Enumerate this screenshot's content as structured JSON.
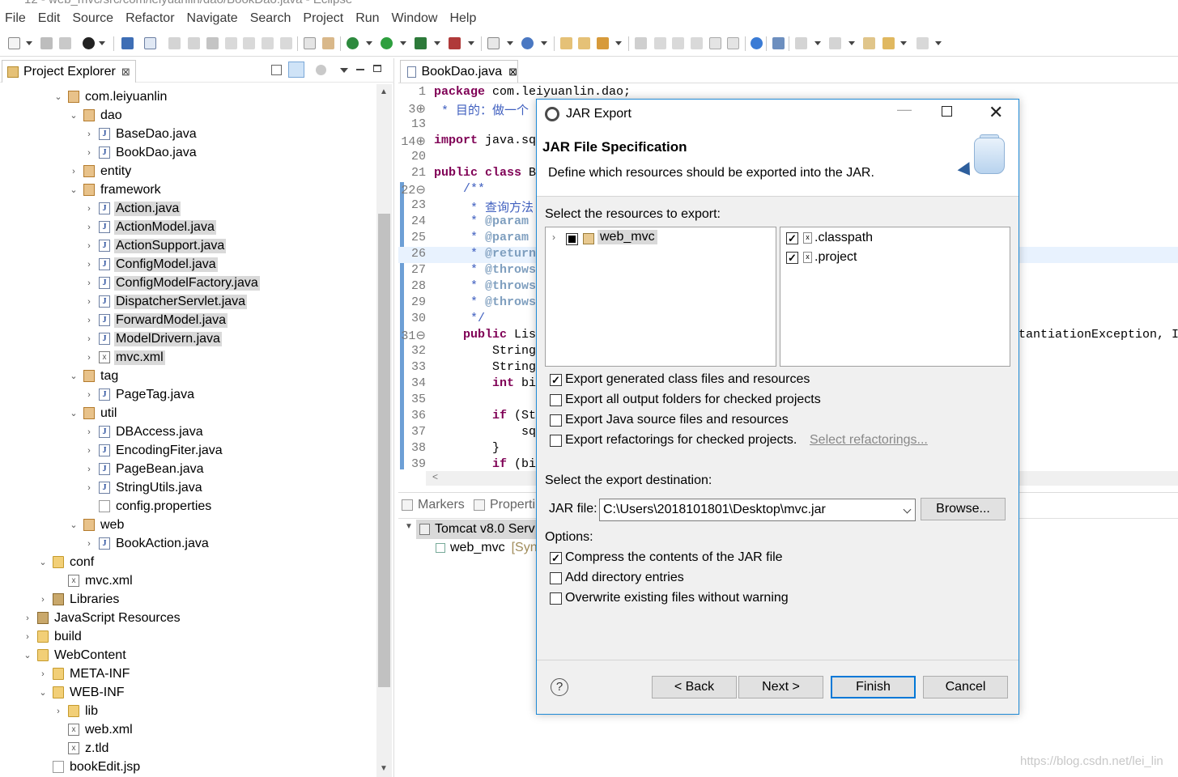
{
  "window": {
    "title": "12 - web_mvc/src/com/leiyuanlin/dao/BookDao.java - Eclipse"
  },
  "menubar": {
    "items": [
      "File",
      "Edit",
      "Source",
      "Refactor",
      "Navigate",
      "Search",
      "Project",
      "Run",
      "Window",
      "Help"
    ]
  },
  "project_explorer": {
    "tab_label": "Project Explorer",
    "close_symbol": "⊠",
    "tree": [
      {
        "label": "com.leiyuanlin",
        "icon": "package-icon",
        "expanded": true,
        "depth": 0
      },
      {
        "label": "dao",
        "icon": "package-icon",
        "expanded": true,
        "depth": 1
      },
      {
        "label": "BaseDao.java",
        "icon": "java-file-icon",
        "depth": 2
      },
      {
        "label": "BookDao.java",
        "icon": "java-file-icon",
        "depth": 2
      },
      {
        "label": "entity",
        "icon": "package-icon",
        "expanded": false,
        "depth": 1
      },
      {
        "label": "framework",
        "icon": "package-icon",
        "expanded": true,
        "depth": 1
      },
      {
        "label": "Action.java",
        "icon": "java-file-icon",
        "depth": 2,
        "selected": true
      },
      {
        "label": "ActionModel.java",
        "icon": "java-file-icon",
        "depth": 2,
        "selected": true
      },
      {
        "label": "ActionSupport.java",
        "icon": "java-file-icon",
        "depth": 2,
        "selected": true
      },
      {
        "label": "ConfigModel.java",
        "icon": "java-file-icon",
        "depth": 2,
        "selected": true
      },
      {
        "label": "ConfigModelFactory.java",
        "icon": "java-file-icon",
        "depth": 2,
        "selected": true
      },
      {
        "label": "DispatcherServlet.java",
        "icon": "java-file-icon",
        "depth": 2,
        "selected": true
      },
      {
        "label": "ForwardModel.java",
        "icon": "java-file-icon",
        "depth": 2,
        "selected": true
      },
      {
        "label": "ModelDrivern.java",
        "icon": "java-file-icon",
        "depth": 2,
        "selected": true
      },
      {
        "label": "mvc.xml",
        "icon": "xml-file-icon",
        "depth": 2,
        "selected": true
      },
      {
        "label": "tag",
        "icon": "package-icon",
        "expanded": true,
        "depth": 1
      },
      {
        "label": "PageTag.java",
        "icon": "java-file-icon",
        "depth": 2
      },
      {
        "label": "util",
        "icon": "package-icon",
        "expanded": true,
        "depth": 1
      },
      {
        "label": "DBAccess.java",
        "icon": "java-file-icon",
        "depth": 2
      },
      {
        "label": "EncodingFiter.java",
        "icon": "java-file-icon",
        "depth": 2
      },
      {
        "label": "PageBean.java",
        "icon": "java-file-icon",
        "depth": 2
      },
      {
        "label": "StringUtils.java",
        "icon": "java-file-icon",
        "depth": 2
      },
      {
        "label": "config.properties",
        "icon": "properties-file-icon",
        "depth": 2,
        "leaf": true
      },
      {
        "label": "web",
        "icon": "package-icon",
        "expanded": true,
        "depth": 1
      },
      {
        "label": "BookAction.java",
        "icon": "java-file-icon",
        "depth": 2
      },
      {
        "label": "conf",
        "icon": "source-folder-icon",
        "expanded": true,
        "depth": -1
      },
      {
        "label": "mvc.xml",
        "icon": "xml-file-icon",
        "depth": 0,
        "leaf": true
      },
      {
        "label": "Libraries",
        "icon": "library-icon",
        "expanded": false,
        "depth": -1
      },
      {
        "label": "JavaScript Resources",
        "icon": "js-resources-icon",
        "expanded": false,
        "depth": -2
      },
      {
        "label": "build",
        "icon": "folder-icon",
        "expanded": false,
        "depth": -2
      },
      {
        "label": "WebContent",
        "icon": "folder-icon",
        "expanded": true,
        "depth": -2
      },
      {
        "label": "META-INF",
        "icon": "folder-icon",
        "expanded": false,
        "depth": -1
      },
      {
        "label": "WEB-INF",
        "icon": "folder-icon",
        "expanded": true,
        "depth": -1
      },
      {
        "label": "lib",
        "icon": "folder-icon",
        "expanded": false,
        "depth": 0
      },
      {
        "label": "web.xml",
        "icon": "xml-file-icon",
        "depth": 0,
        "leaf": true
      },
      {
        "label": "z.tld",
        "icon": "xml-file-icon",
        "depth": 0,
        "leaf": true
      },
      {
        "label": "bookEdit.jsp",
        "icon": "jsp-file-icon",
        "depth": -1,
        "leaf": true
      }
    ]
  },
  "editor": {
    "tab_label": "BookDao.java",
    "lines": [
      {
        "num": "1",
        "parts": [
          [
            "kw",
            "package"
          ],
          [
            "",
            "com.leiyuanlin.dao;"
          ]
        ]
      },
      {
        "num": "3⊕",
        "parts": [
          [
            "cm",
            " * 目的：做一个"
          ]
        ]
      },
      {
        "num": "13",
        "parts": []
      },
      {
        "num": "14⊕",
        "parts": [
          [
            "kw",
            "import"
          ],
          [
            "",
            "java.sq"
          ]
        ]
      },
      {
        "num": "20",
        "parts": []
      },
      {
        "num": "21",
        "parts": [
          [
            "kw",
            "public class"
          ],
          [
            "",
            "B"
          ]
        ]
      },
      {
        "num": "22⊖",
        "parts": [
          [
            "cm",
            "    /**"
          ]
        ]
      },
      {
        "num": "23",
        "parts": [
          [
            "cm",
            "     * 查询方法"
          ]
        ]
      },
      {
        "num": "24",
        "parts": [
          [
            "cm",
            "     * "
          ],
          [
            "ann",
            "@param"
          ]
        ]
      },
      {
        "num": "25",
        "parts": [
          [
            "cm",
            "     * "
          ],
          [
            "ann",
            "@param"
          ]
        ]
      },
      {
        "num": "26",
        "parts": [
          [
            "cm",
            "     * "
          ],
          [
            "ann",
            "@return"
          ]
        ]
      },
      {
        "num": "27",
        "parts": [
          [
            "cm",
            "     * "
          ],
          [
            "ann",
            "@throws"
          ]
        ]
      },
      {
        "num": "28",
        "parts": [
          [
            "cm",
            "     * "
          ],
          [
            "ann",
            "@throws"
          ]
        ]
      },
      {
        "num": "29",
        "parts": [
          [
            "cm",
            "     * "
          ],
          [
            "ann",
            "@throws"
          ]
        ]
      },
      {
        "num": "30",
        "parts": [
          [
            "cm",
            "     */"
          ]
        ]
      },
      {
        "num": "31⊖",
        "parts": [
          [
            "kw",
            "    public"
          ],
          [
            "",
            "Lis"
          ]
        ]
      },
      {
        "num": "32",
        "parts": [
          [
            "",
            "        String"
          ]
        ]
      },
      {
        "num": "33",
        "parts": [
          [
            "",
            "        String"
          ]
        ]
      },
      {
        "num": "34",
        "parts": [
          [
            "kw",
            "        int"
          ],
          [
            "",
            "bi"
          ]
        ]
      },
      {
        "num": "35",
        "parts": []
      },
      {
        "num": "36",
        "parts": [
          [
            "kw",
            "        if"
          ],
          [
            "",
            "(Str"
          ]
        ]
      },
      {
        "num": "37",
        "parts": [
          [
            "",
            "            sq"
          ]
        ]
      },
      {
        "num": "38",
        "parts": [
          [
            "",
            "        }"
          ]
        ]
      },
      {
        "num": "39",
        "parts": [
          [
            "kw",
            "        if"
          ],
          [
            "",
            "(bid"
          ]
        ]
      }
    ],
    "overflow_text": "tantiationException, I"
  },
  "bottom_panel": {
    "tabs": [
      "Markers",
      "Properti"
    ],
    "server_label": "Tomcat v8.0 Serv",
    "project_label": "web_mvc",
    "project_status": "[Syn"
  },
  "dialog": {
    "title": "JAR Export",
    "heading": "JAR File Specification",
    "description": "Define which resources should be exported into the JAR.",
    "resources_label": "Select the resources to export:",
    "tree_item": "web_mvc",
    "files": [
      {
        "label": ".classpath",
        "checked": true
      },
      {
        "label": ".project",
        "checked": true
      }
    ],
    "export_options": [
      {
        "label": "Export generated class files and resources",
        "checked": true
      },
      {
        "label": "Export all output folders for checked projects",
        "checked": false
      },
      {
        "label": "Export Java source files and resources",
        "checked": false
      },
      {
        "label": "Export refactorings for checked projects.",
        "checked": false
      }
    ],
    "select_refactorings_link": "Select refactorings...",
    "destination_label": "Select the export destination:",
    "jar_file_label": "JAR file:",
    "jar_file_value": "C:\\Users\\2018101801\\Desktop\\mvc.jar",
    "browse_label": "Browse...",
    "options_label": "Options:",
    "options": [
      {
        "label": "Compress the contents of the JAR file",
        "checked": true
      },
      {
        "label": "Add directory entries",
        "checked": false
      },
      {
        "label": "Overwrite existing files without warning",
        "checked": false
      }
    ],
    "buttons": {
      "help": "?",
      "back": "< Back",
      "next": "Next >",
      "finish": "Finish",
      "cancel": "Cancel"
    }
  },
  "watermark": "https://blog.csdn.net/lei_lin",
  "colors": {
    "accent": "#0078d7",
    "keyword": "#7f0055",
    "comment": "#3f5fbf",
    "selection": "#d9d9d9"
  }
}
